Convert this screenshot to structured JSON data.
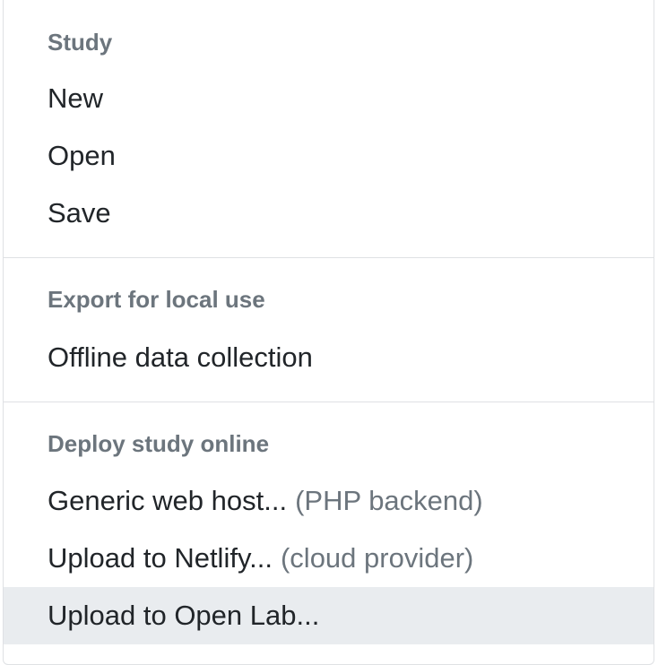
{
  "menu": {
    "sections": [
      {
        "header": "Study",
        "items": [
          {
            "label": "New"
          },
          {
            "label": "Open"
          },
          {
            "label": "Save"
          }
        ]
      },
      {
        "header": "Export for local use",
        "items": [
          {
            "label": "Offline data collection"
          }
        ]
      },
      {
        "header": "Deploy study online",
        "items": [
          {
            "label": "Generic web host...",
            "hint": "(PHP backend)"
          },
          {
            "label": "Upload to Netlify...",
            "hint": "(cloud provider)"
          },
          {
            "label": "Upload to Open Lab...",
            "highlighted": true
          }
        ]
      }
    ]
  },
  "colors": {
    "header_text": "#6c757d",
    "item_text": "#212529",
    "hint_text": "#6c757d",
    "highlight_bg": "#e9ecef",
    "divider": "#dfe1e4"
  }
}
